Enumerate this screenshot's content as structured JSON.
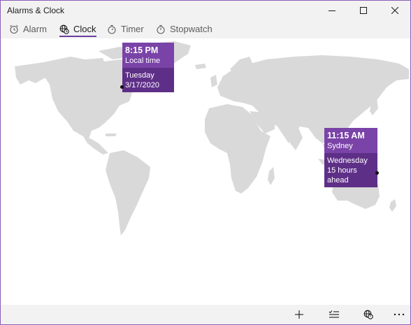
{
  "window": {
    "title": "Alarms & Clock"
  },
  "tabs": [
    {
      "label": "Alarm",
      "icon": "alarm-clock-icon",
      "active": false
    },
    {
      "label": "Clock",
      "icon": "globe-clock-icon",
      "active": true
    },
    {
      "label": "Timer",
      "icon": "stopwatch-icon",
      "active": false
    },
    {
      "label": "Stopwatch",
      "icon": "stopwatch-icon",
      "active": false
    }
  ],
  "clocks": [
    {
      "time": "8:15 PM",
      "place": "Local time",
      "day": "Tuesday",
      "detail": "3/17/2020"
    },
    {
      "time": "11:15 AM",
      "place": "Sydney",
      "day": "Wednesday",
      "detail": "15 hours ahead"
    }
  ],
  "colors": {
    "accent": "#6b3fa0",
    "popup_header": "#7a43a8",
    "popup_body": "#5e2f87",
    "land": "#d9d9d9",
    "chrome": "#f2f2f2"
  },
  "commands": [
    {
      "icon": "add-icon"
    },
    {
      "icon": "select-list-icon"
    },
    {
      "icon": "compare-clocks-icon"
    },
    {
      "icon": "more-icon"
    }
  ]
}
